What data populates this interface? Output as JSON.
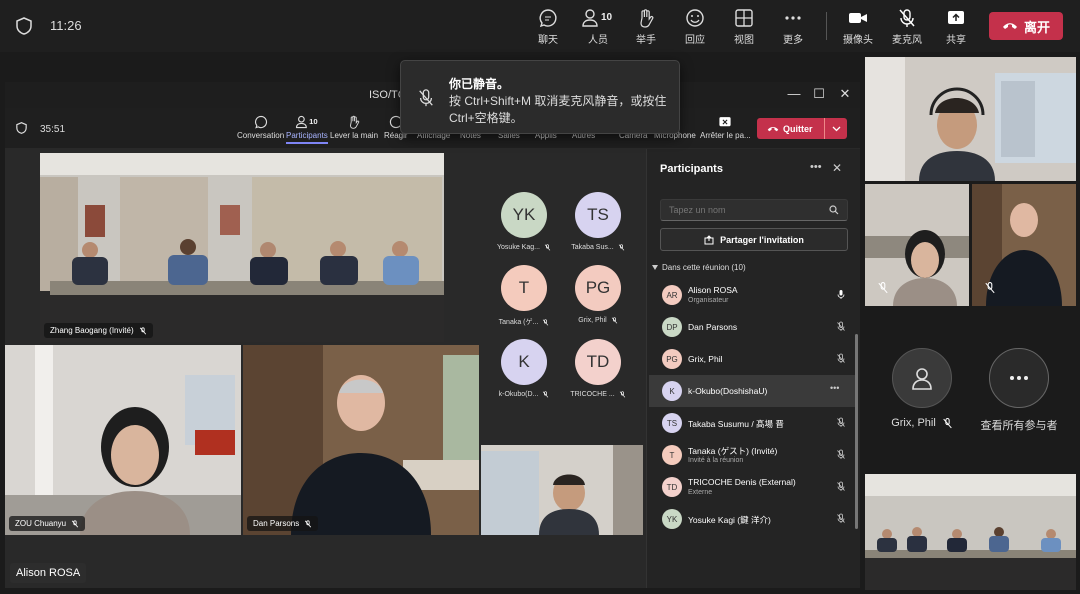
{
  "topbar": {
    "time": "11:26",
    "buttons": [
      {
        "label": "聊天",
        "icon": "chat-icon"
      },
      {
        "label": "人员",
        "icon": "people-icon",
        "count": "10"
      },
      {
        "label": "举手",
        "icon": "raise-hand-icon"
      },
      {
        "label": "回应",
        "icon": "react-icon"
      },
      {
        "label": "视图",
        "icon": "view-icon"
      },
      {
        "label": "更多",
        "icon": "more-icon"
      },
      {
        "label": "摄像头",
        "icon": "camera-icon"
      },
      {
        "label": "麦克风",
        "icon": "mic-off-icon"
      },
      {
        "label": "共享",
        "icon": "share-icon"
      }
    ],
    "leave_label": "离开",
    "leave_color": "#c4314b"
  },
  "toast": {
    "title": "你已静音。",
    "body": "按 Ctrl+Shift+M 取消麦克风静音，或按住 Ctrl+空格键。"
  },
  "inner": {
    "title": "ISO/TC",
    "time": "35:51",
    "buttons": [
      {
        "label": "Conversation",
        "icon": "chat-icon"
      },
      {
        "label": "Participants",
        "icon": "people-icon",
        "count": "10",
        "active": true
      },
      {
        "label": "Lever la main",
        "icon": "raise-hand-icon"
      },
      {
        "label": "Réagir",
        "icon": "react-icon"
      },
      {
        "label": "Affichage",
        "icon": "view-icon"
      },
      {
        "label": "Notes",
        "icon": "notes-icon"
      },
      {
        "label": "Salles",
        "icon": "rooms-icon"
      },
      {
        "label": "Applis",
        "icon": "apps-icon"
      },
      {
        "label": "Autres",
        "icon": "more-icon"
      },
      {
        "label": "Caméra",
        "icon": "camera-icon"
      },
      {
        "label": "Microphone",
        "icon": "mic-icon"
      },
      {
        "label": "Arrêter le pa...",
        "icon": "stop-share-icon"
      }
    ],
    "quit_label": "Quitter",
    "tiles": {
      "zhang": "Zhang Baogang (Invité)",
      "zou": "ZOU Chuanyu",
      "dan": "Dan Parsons"
    },
    "avatars": [
      {
        "initials": "YK",
        "name": "Yosuke Kag...",
        "color": "#c9d8c5"
      },
      {
        "initials": "TS",
        "name": "Takaba Sus...",
        "color": "#d7d3f0"
      },
      {
        "initials": "T",
        "name": "Tanaka (ゲ...",
        "color": "#f4cbbd"
      },
      {
        "initials": "PG",
        "name": "Grix, Phil",
        "color": "#f3cbc0"
      },
      {
        "initials": "K",
        "name": "k-Okubo(D...",
        "color": "#d7d3f0"
      },
      {
        "initials": "TD",
        "name": "TRICOCHE ...",
        "color": "#f3d1cc"
      }
    ]
  },
  "participants": {
    "title": "Participants",
    "search_placeholder": "Tapez un nom",
    "share_label": "Partager l'invitation",
    "section_label": "Dans cette réunion (10)",
    "list": [
      {
        "initials": "AR",
        "name": "Alison ROSA",
        "sub": "Organisateur",
        "color": "#f3cbc0",
        "mic": "on"
      },
      {
        "initials": "DP",
        "name": "Dan Parsons",
        "sub": "",
        "color": "#c9d8c5",
        "mic": "off"
      },
      {
        "initials": "PG",
        "name": "Grix, Phil",
        "sub": "",
        "color": "#f3cbc0",
        "mic": "off"
      },
      {
        "initials": "K",
        "name": "k-Okubo(DoshishaU)",
        "sub": "",
        "color": "#d7d3f0",
        "mic": "more"
      },
      {
        "initials": "TS",
        "name": "Takaba Susumu / 髙場 晋",
        "sub": "",
        "color": "#d7d3f0",
        "mic": "off"
      },
      {
        "initials": "T",
        "name": "Tanaka (ゲスト) (Invité)",
        "sub": "Invité à la réunion",
        "color": "#f4cbbd",
        "mic": "off"
      },
      {
        "initials": "TD",
        "name": "TRICOCHE Denis (External)",
        "sub": "Externe",
        "color": "#f3d1cc",
        "mic": "off"
      },
      {
        "initials": "YK",
        "name": "Yosuke Kagi (鍵 洋介)",
        "sub": "",
        "color": "#c9d8c5",
        "mic": "off"
      }
    ]
  },
  "right": {
    "grix_label": "Grix, Phil",
    "view_all_label": "查看所有参与者"
  },
  "self_name": "Alison ROSA"
}
